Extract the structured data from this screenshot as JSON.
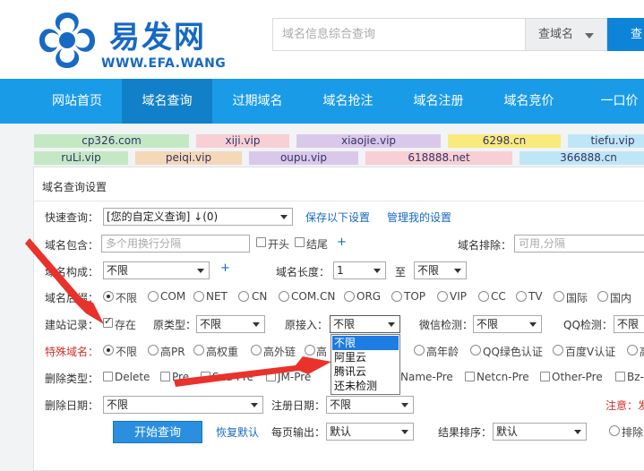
{
  "logo": {
    "text": "易发网",
    "url": "WWW.EFA.WANG"
  },
  "search": {
    "placeholder": "域名信息综合查询",
    "type": "查域名",
    "button": "查询"
  },
  "nav": [
    "网站首页",
    "域名查询",
    "过期域名",
    "域名抢注",
    "域名注册",
    "域名竞价",
    "一口价"
  ],
  "links": {
    "row1": [
      "cp326.com",
      "xiji.vip",
      "xiaojie.vip",
      "6298.cn",
      "tiefu.vip"
    ],
    "row2": [
      "ruLi.vip",
      "peiqi.vip",
      "oupu.vip",
      "618888.net",
      "366888.cn"
    ]
  },
  "colors": {
    "nav": "#1a9be8",
    "nav_active": "#1280c9",
    "accent": "#1769c4",
    "warn": "#d0312d"
  },
  "panel": {
    "title": "域名查询设置",
    "quick": {
      "label": "快速查询：",
      "value": "[您的自定义查询] ↓(0)",
      "save": "保存以下设置",
      "manage": "管理我的设置"
    },
    "contain": {
      "label": "域名包含：",
      "placeholder": "多个用换行分隔",
      "start": "开头",
      "end": "结尾",
      "exclude_label": "域名排除：",
      "exclude_placeholder": "可用,分隔"
    },
    "compose": {
      "label": "域名构成：",
      "value": "不限",
      "length_label": "域名长度：",
      "length_min": "1",
      "to": "至",
      "length_max": "不限"
    },
    "suffix": {
      "label": "域名后缀：",
      "options": [
        "不限",
        "COM",
        "NET",
        "CN",
        "COM.CN",
        "ORG",
        "TOP",
        "VIP",
        "CC",
        "TV",
        "国际",
        "国内"
      ]
    },
    "site": {
      "label": "建站记录：",
      "exists": "存在",
      "type_label": "原类型：",
      "type_value": "不限",
      "access_label": "原接入：",
      "access_value": "不限",
      "wechat_label": "微信检测：",
      "wechat_value": "不限",
      "qq_label": "QQ检测：",
      "qq_value": "不限"
    },
    "access_options": [
      "不限",
      "阿里云",
      "腾讯云",
      "还未检测"
    ],
    "special": {
      "label": "特殊域名：",
      "options": [
        "不限",
        "高PR",
        "高权重",
        "高外链",
        "高",
        "高年龄",
        "QQ绿色认证",
        "百度V认证",
        "高"
      ]
    },
    "delete_type": {
      "label": "删除类型：",
      "options": [
        "Delete",
        "Pre",
        "Sna-Pre",
        "JM-Pre",
        "Name-Pre",
        "Netcn-Pre",
        "Other-Pre",
        "Bz-"
      ]
    },
    "delete_date": {
      "label": "删除日期：",
      "value": "不限",
      "reg_label": "注册日期：",
      "reg_value": "不限",
      "note": "注意：发"
    },
    "actions": {
      "start": "开始查询",
      "reset": "恢复默认",
      "per_page_label": "每页输出：",
      "per_page": "默认",
      "sort_label": "结果排序：",
      "sort": "默认",
      "sort_option": "排除"
    }
  }
}
